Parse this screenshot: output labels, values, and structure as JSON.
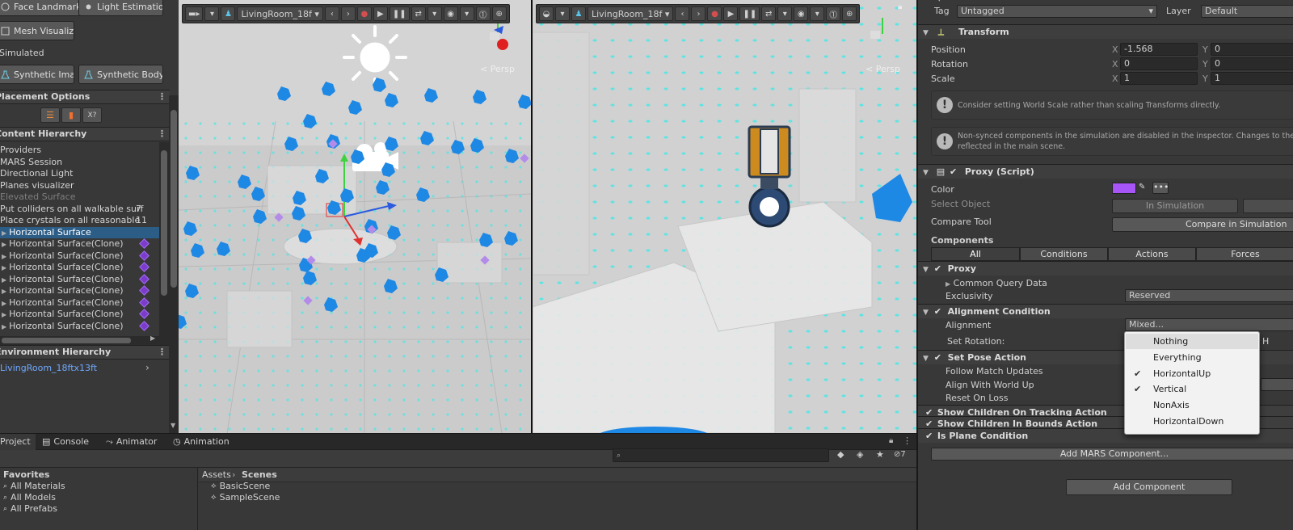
{
  "left_panel": {
    "buttons": [
      {
        "label": "Face Landmarks",
        "icon": "face-icon"
      },
      {
        "label": "Light Estimation",
        "icon": "light-icon"
      },
      {
        "label": "Mesh Visualizer",
        "icon": "mesh-icon"
      },
      {
        "label": "Synthetic Image",
        "icon": "flask-icon"
      },
      {
        "label": "Synthetic Body",
        "icon": "flask-icon"
      }
    ],
    "simulated_label": "Simulated",
    "placement_options": {
      "title": "Placement Options",
      "tools": [
        "rule",
        "book",
        "X?"
      ]
    },
    "content_hierarchy": {
      "title": "Content Hierarchy",
      "items": [
        {
          "label": "Providers",
          "count": "",
          "state": "normal",
          "diamond": false
        },
        {
          "label": "MARS Session",
          "count": "",
          "state": "normal",
          "diamond": false
        },
        {
          "label": "Directional Light",
          "count": "",
          "state": "normal",
          "diamond": false
        },
        {
          "label": "Planes visualizer",
          "count": "",
          "state": "normal",
          "diamond": false
        },
        {
          "label": "Elevated Surface",
          "count": "",
          "state": "dim",
          "diamond": false
        },
        {
          "label": "Put colliders on all walkable surf",
          "count": "7",
          "state": "normal",
          "diamond": false
        },
        {
          "label": "Place crystals on all reasonable",
          "count": "11",
          "state": "normal",
          "diamond": false
        },
        {
          "label": "Horizontal Surface",
          "count": "",
          "state": "selected",
          "diamond": false
        },
        {
          "label": "Horizontal Surface(Clone)",
          "count": "",
          "state": "normal",
          "diamond": true
        },
        {
          "label": "Horizontal Surface(Clone)",
          "count": "",
          "state": "normal",
          "diamond": true
        },
        {
          "label": "Horizontal Surface(Clone)",
          "count": "",
          "state": "normal",
          "diamond": true
        },
        {
          "label": "Horizontal Surface(Clone)",
          "count": "",
          "state": "normal",
          "diamond": true
        },
        {
          "label": "Horizontal Surface(Clone)",
          "count": "",
          "state": "normal",
          "diamond": true
        },
        {
          "label": "Horizontal Surface(Clone)",
          "count": "",
          "state": "normal",
          "diamond": true
        },
        {
          "label": "Horizontal Surface(Clone)",
          "count": "",
          "state": "normal",
          "diamond": true
        },
        {
          "label": "Horizontal Surface(Clone)",
          "count": "",
          "state": "normal",
          "diamond": true
        }
      ]
    },
    "environment_hierarchy": {
      "title": "Environment Hierarchy",
      "item": "LivingRoom_18ftx13ft"
    }
  },
  "viewports": {
    "scene": {
      "environment": "LivingRoom_18f",
      "persp": "Persp"
    },
    "simulation": {
      "environment": "LivingRoom_18f",
      "persp": "Persp"
    }
  },
  "bottom_panel": {
    "tabs": [
      "Project",
      "Console",
      "Animator",
      "Animation"
    ],
    "favorites_title": "Favorites",
    "favorites": [
      "All Materials",
      "All Models",
      "All Prefabs"
    ],
    "breadcrumb": [
      "Assets",
      "Scenes"
    ],
    "scenes": [
      "BasicScene",
      "SampleScene"
    ],
    "search_placeholder": "",
    "hidden_count": "7"
  },
  "inspector": {
    "tag_label": "Tag",
    "tag_value": "Untagged",
    "layer_label": "Layer",
    "layer_value": "Default",
    "transform": {
      "title": "Transform",
      "position": {
        "label": "Position",
        "x": "-1.568",
        "y": "0"
      },
      "rotation": {
        "label": "Rotation",
        "x": "0",
        "y": "0"
      },
      "scale": {
        "label": "Scale",
        "x": "1",
        "y": "1"
      }
    },
    "help_1": "Consider setting World Scale rather than scaling Transforms directly.",
    "help_2_line1": "Non-synced components in the simulation are disabled in the inspector. Changes to these",
    "help_2_line2": "reflected in the main scene.",
    "proxy_script": {
      "title": "Proxy (Script)",
      "color_label": "Color",
      "color_value": "#a855f7",
      "select_object_label": "Select Object",
      "in_simulation": "In Simulation",
      "compare_tool_label": "Compare Tool",
      "compare_in_simulation": "Compare in Simulation"
    },
    "components": {
      "title": "Components",
      "tabs": [
        "All",
        "Conditions",
        "Actions",
        "Forces"
      ]
    },
    "proxy": {
      "title": "Proxy",
      "common_query": "Common Query Data",
      "exclusivity_label": "Exclusivity",
      "exclusivity_value": "Reserved"
    },
    "alignment_condition": {
      "title": "Alignment Condition",
      "alignment_label": "Alignment",
      "alignment_value": "Mixed...",
      "set_rotation_label": "Set Rotation:",
      "set_rotation_value": "H"
    },
    "set_pose_action": {
      "title": "Set Pose Action",
      "follow": "Follow Match Updates",
      "align": "Align With World Up",
      "reset": "Reset On Loss"
    },
    "show_children_tracking": "Show Children On Tracking Action",
    "show_children_bounds": "Show Children In Bounds Action",
    "is_plane": "Is Plane Condition",
    "add_mars_component": "Add MARS Component...",
    "add_component": "Add Component"
  },
  "dropdown": {
    "items": [
      {
        "label": "Nothing",
        "checked": false,
        "hover": true
      },
      {
        "label": "Everything",
        "checked": false,
        "hover": false
      },
      {
        "label": "HorizontalUp",
        "checked": true,
        "hover": false
      },
      {
        "label": "Vertical",
        "checked": true,
        "hover": false
      },
      {
        "label": "NonAxis",
        "checked": false,
        "hover": false
      },
      {
        "label": "HorizontalDown",
        "checked": false,
        "hover": false
      }
    ]
  },
  "colors": {
    "accent_blue": "#2c5d87",
    "crystal_blue": "#1e88e5",
    "dot_cyan": "#4ee6e6",
    "proxy_purple": "#a855f7"
  }
}
